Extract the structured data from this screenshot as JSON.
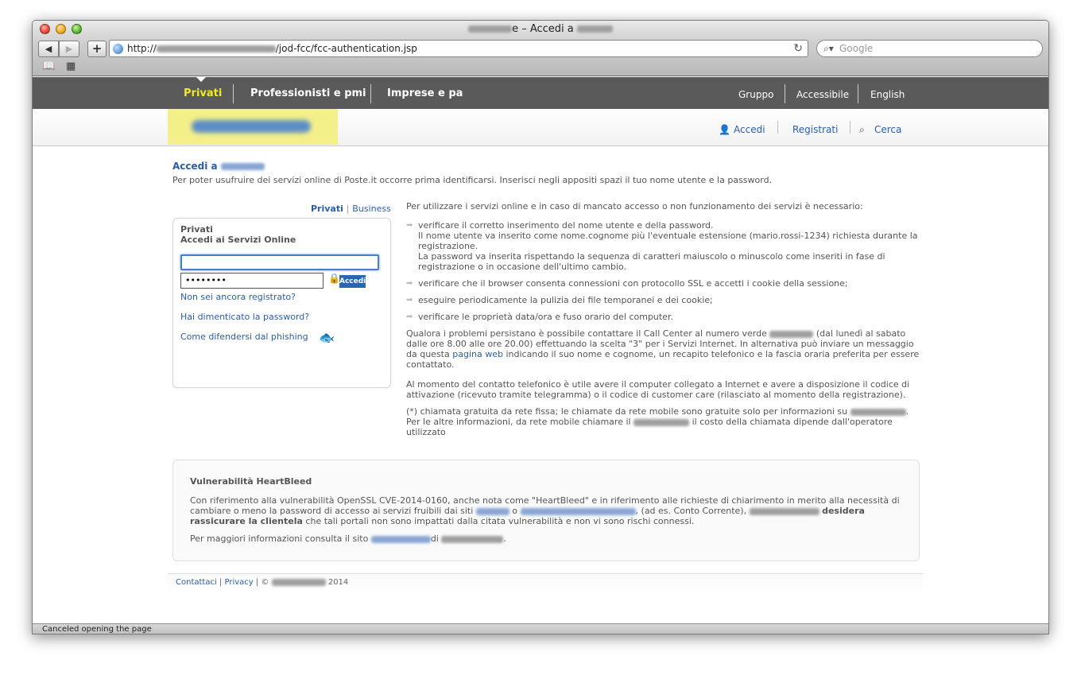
{
  "window": {
    "title_suffix": "e – Accedi a"
  },
  "toolbar": {
    "back": "◀",
    "forward": "▶",
    "add": "+",
    "url_prefix": "http://",
    "url_path": "/jod-fcc/fcc-authentication.jsp",
    "reload": "↻",
    "search_placeholder": "Google",
    "bookmarks_icon": "book-icon",
    "topsites_icon": "grid-icon"
  },
  "topnav": {
    "items": [
      "Privati",
      "Professionisti e pmi",
      "Imprese e pa"
    ],
    "right_items": [
      "Gruppo",
      "Accessibile",
      "English"
    ]
  },
  "header": {
    "links": [
      "Accedi",
      "Registrati",
      "Cerca"
    ]
  },
  "page": {
    "title": "Accedi a",
    "intro": "Per poter usufruire dei servizi online di Poste.it occorre prima identificarsi. Inserisci negli appositi spazi il tuo nome utente e la password."
  },
  "login": {
    "tab_privati": "Privati",
    "tab_sep": "|",
    "tab_business": "Business",
    "box_title": "Privati",
    "box_subtitle": "Accedi ai Servizi Online",
    "username_value": "",
    "password_value": "••••••••",
    "submit": "Accedi",
    "link_register": "Non sei ancora registrato?",
    "link_forgot": "Hai dimenticato la password?",
    "link_phishing": "Come difendersi dal phishing"
  },
  "info": {
    "intro": "Per utilizzare i servizi online e in caso di mancato accesso o non funzionamento dei servizi è necessario:",
    "b1_l1": "verificare il corretto inserimento del nome utente e della password.",
    "b1_l2": "Il nome utente va inserito come nome.cognome più l'eventuale estensione (mario.rossi-1234) richiesta durante la registrazione.",
    "b1_l3": "La password va inserita rispettando la sequenza di caratteri maiuscolo o minuscolo come inseriti in fase di registrazione o in occasione dell'ultimo cambio.",
    "b2": "verificare che il browser consenta connessioni con protocollo SSL e accetti i cookie della sessione;",
    "b3": "eseguire periodicamente la pulizia dei file temporanei e dei cookie;",
    "b4": "verificare le proprietà data/ora e fuso orario del computer.",
    "p1_a": "Qualora i problemi persistano è possibile contattare il Call Center al numero verde",
    "p1_b": "(dal lunedì al sabato dalle ore 8.00 alle ore 20.00) effettuando la scelta \"3\" per i Servizi Internet. In alternativa può inviare un messaggio da questa",
    "p1_link": "pagina web",
    "p1_c": "indicando il suo nome e cognome, un recapito telefonico e la fascia oraria preferita per essere contattato.",
    "p2": "Al momento del contatto telefonico è utile avere il computer collegato a Internet e avere a disposizione il codice di attivazione (ricevuto tramite telegramma) o il codice di customer care (rilasciato al momento della registrazione).",
    "p3_a": "(*) chiamata gratuita da rete fissa; le chiamate da rete mobile sono gratuite solo per informazioni su",
    "p3_b": ". Per le altre informazioni, da rete mobile chiamare il",
    "p3_c": "il costo della chiamata dipende dall'operatore utilizzato"
  },
  "heartbleed": {
    "title": "Vulnerabilità HeartBleed",
    "p1_a": "Con riferimento alla vulnerabilità OpenSSL CVE-2014-0160, anche nota come \"HeartBleed\" e in riferimento alle richieste di chiarimento in merito alla necessità di cambiare o meno la password di accesso ai servizi fruibili dai siti",
    "p1_o": "o",
    "p1_b": ", (ad es. Conto Corrente),",
    "p1_bold": "desidera rassicurare la clientela",
    "p1_c": "che tali portali non sono impattati dalla citata vulnerabilità e non vi sono rischi connessi.",
    "p2_a": "Per maggiori informazioni consulta il sito",
    "p2_di": "di",
    "p2_end": "."
  },
  "footer": {
    "contact": "Contattaci",
    "sep": "|",
    "privacy": "Privacy",
    "copy": "| ©",
    "year": "2014"
  },
  "status": {
    "text": "Canceled opening the page"
  },
  "colors": {
    "nav_bg": "#5a5a5a",
    "nav_active": "#f2e92a",
    "link": "#2a5ea8",
    "button": "#2a66b0"
  }
}
